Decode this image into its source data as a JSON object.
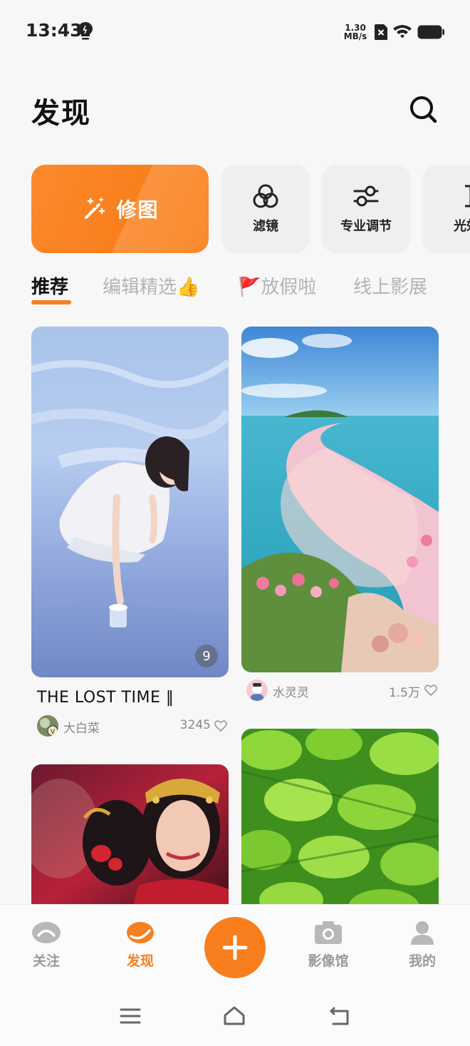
{
  "status_bar": {
    "time": "13:43",
    "speed_value": "1.30",
    "speed_unit": "MB/s",
    "icons": [
      "lightbulb-icon",
      "sim-off-icon",
      "wifi-icon",
      "battery-icon"
    ]
  },
  "header": {
    "title": "发现",
    "search_icon": "search-icon"
  },
  "tools": {
    "primary": {
      "label": "修图",
      "icon": "magic-wand-icon"
    },
    "items": [
      {
        "label": "滤镜",
        "icon": "filter-circles-icon"
      },
      {
        "label": "专业调节",
        "icon": "sliders-icon"
      },
      {
        "label": "光效",
        "icon": "light-effect-icon"
      }
    ]
  },
  "tabs": {
    "items": [
      "推荐",
      "编辑精选👍",
      "🚩放假啦",
      "线上影展"
    ],
    "active_index": 0
  },
  "feed": {
    "cards": [
      {
        "title": "THE LOST TIME ‖",
        "author": "大白菜",
        "likes": "3245",
        "page_count": "9"
      },
      {
        "author": "水灵灵",
        "likes": "1.5万"
      },
      {},
      {}
    ]
  },
  "bottom_nav": {
    "items": [
      {
        "label": "关注",
        "icon": "follow-icon"
      },
      {
        "label": "发现",
        "icon": "discover-icon",
        "active": true
      },
      {
        "label": "影像馆",
        "icon": "camera-icon"
      },
      {
        "label": "我的",
        "icon": "profile-icon"
      }
    ],
    "create_icon": "plus-icon"
  },
  "system_nav": [
    "menu-icon",
    "home-icon",
    "back-icon"
  ],
  "colors": {
    "accent": "#f97e1e",
    "background": "#f7f7f8",
    "tile": "#efeff0",
    "inactive_text": "#9a9a9a"
  }
}
